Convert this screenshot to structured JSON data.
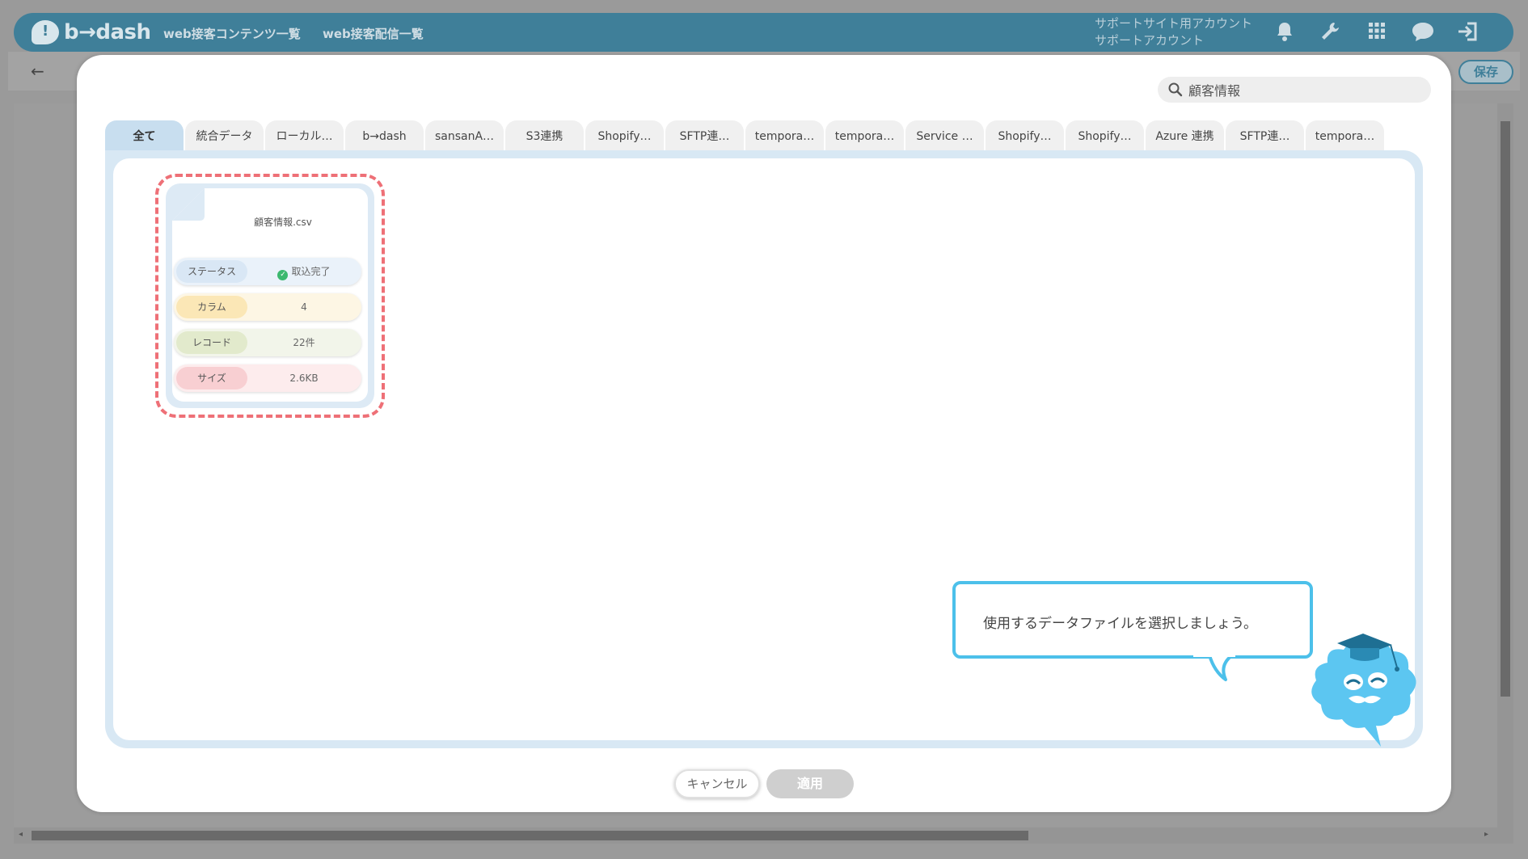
{
  "header": {
    "logo_text": "b→dash",
    "nav": [
      {
        "label": "web接客コンテンツ一覧"
      },
      {
        "label": "web接客配信一覧"
      }
    ],
    "account_line1": "サポートサイト用アカウント",
    "account_line2": "サポートアカウント",
    "icons": [
      "bell-icon",
      "wrench-icon",
      "grid-icon",
      "chat-icon",
      "logout-icon"
    ]
  },
  "subbar": {
    "save_label": "保存"
  },
  "modal": {
    "search": {
      "value": "顧客情報"
    },
    "tabs": [
      {
        "label": "全て",
        "active": true
      },
      {
        "label": "統合データ"
      },
      {
        "label": "ローカル…"
      },
      {
        "label": "b→dash"
      },
      {
        "label": "sansanA…"
      },
      {
        "label": "S3連携"
      },
      {
        "label": "Shopify…"
      },
      {
        "label": "SFTP連…"
      },
      {
        "label": "tempora…"
      },
      {
        "label": "tempora…"
      },
      {
        "label": "Service …"
      },
      {
        "label": "Shopify…"
      },
      {
        "label": "Shopify…"
      },
      {
        "label": "Azure 連携"
      },
      {
        "label": "SFTP連…"
      },
      {
        "label": "tempora…"
      }
    ],
    "file_card": {
      "file_name": "顧客情報.csv",
      "status_label": "ステータス",
      "status_value": "取込完了",
      "column_label": "カラム",
      "column_value": "4",
      "record_label": "レコード",
      "record_value": "22件",
      "size_label": "サイズ",
      "size_value": "2.6KB"
    },
    "guide_message": "使用するデータファイルを選択しましょう。",
    "cancel_label": "キャンセル",
    "apply_label": "適用"
  },
  "colors": {
    "brand": "#4aa3c9",
    "highlight": "#ee7077",
    "bubble_border": "#4cc0ea",
    "status_ok": "#3cb86f"
  }
}
